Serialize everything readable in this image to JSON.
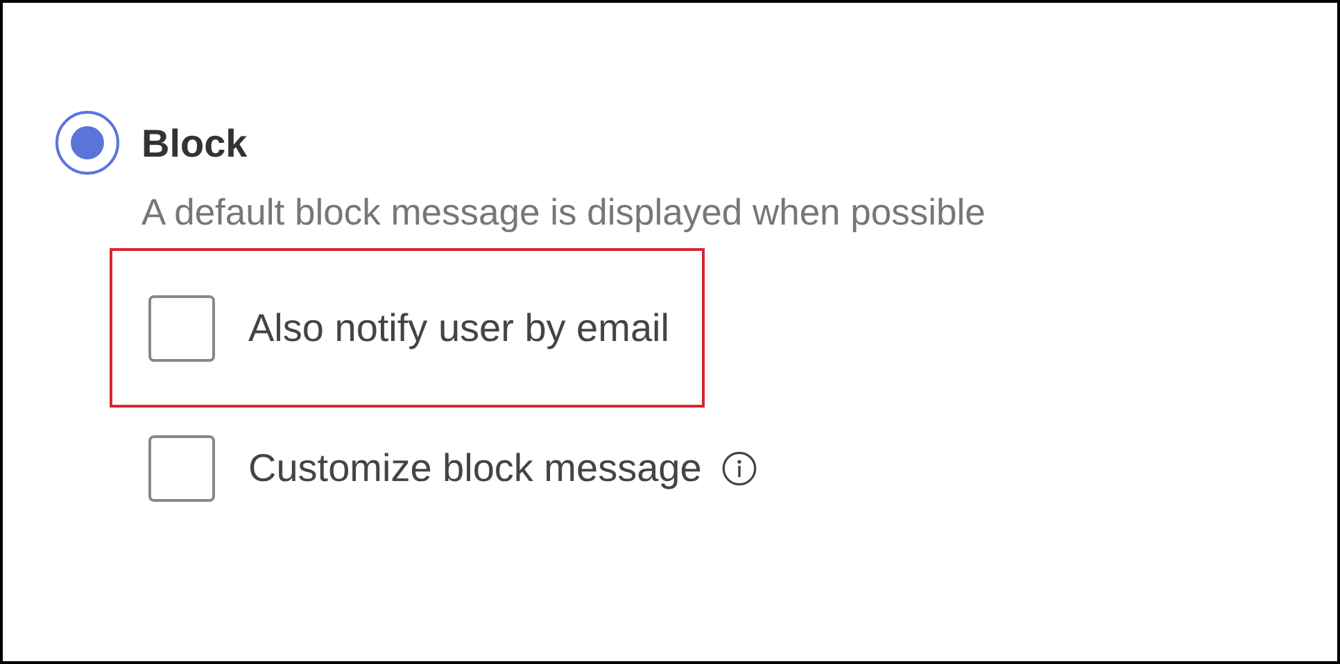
{
  "radio": {
    "label": "Block",
    "selected": true,
    "description": "A default block message is displayed when possible"
  },
  "options": [
    {
      "label": "Also notify user by email",
      "checked": false,
      "highlighted": true,
      "info": false
    },
    {
      "label": "Customize block message",
      "checked": false,
      "highlighted": false,
      "info": true
    }
  ]
}
